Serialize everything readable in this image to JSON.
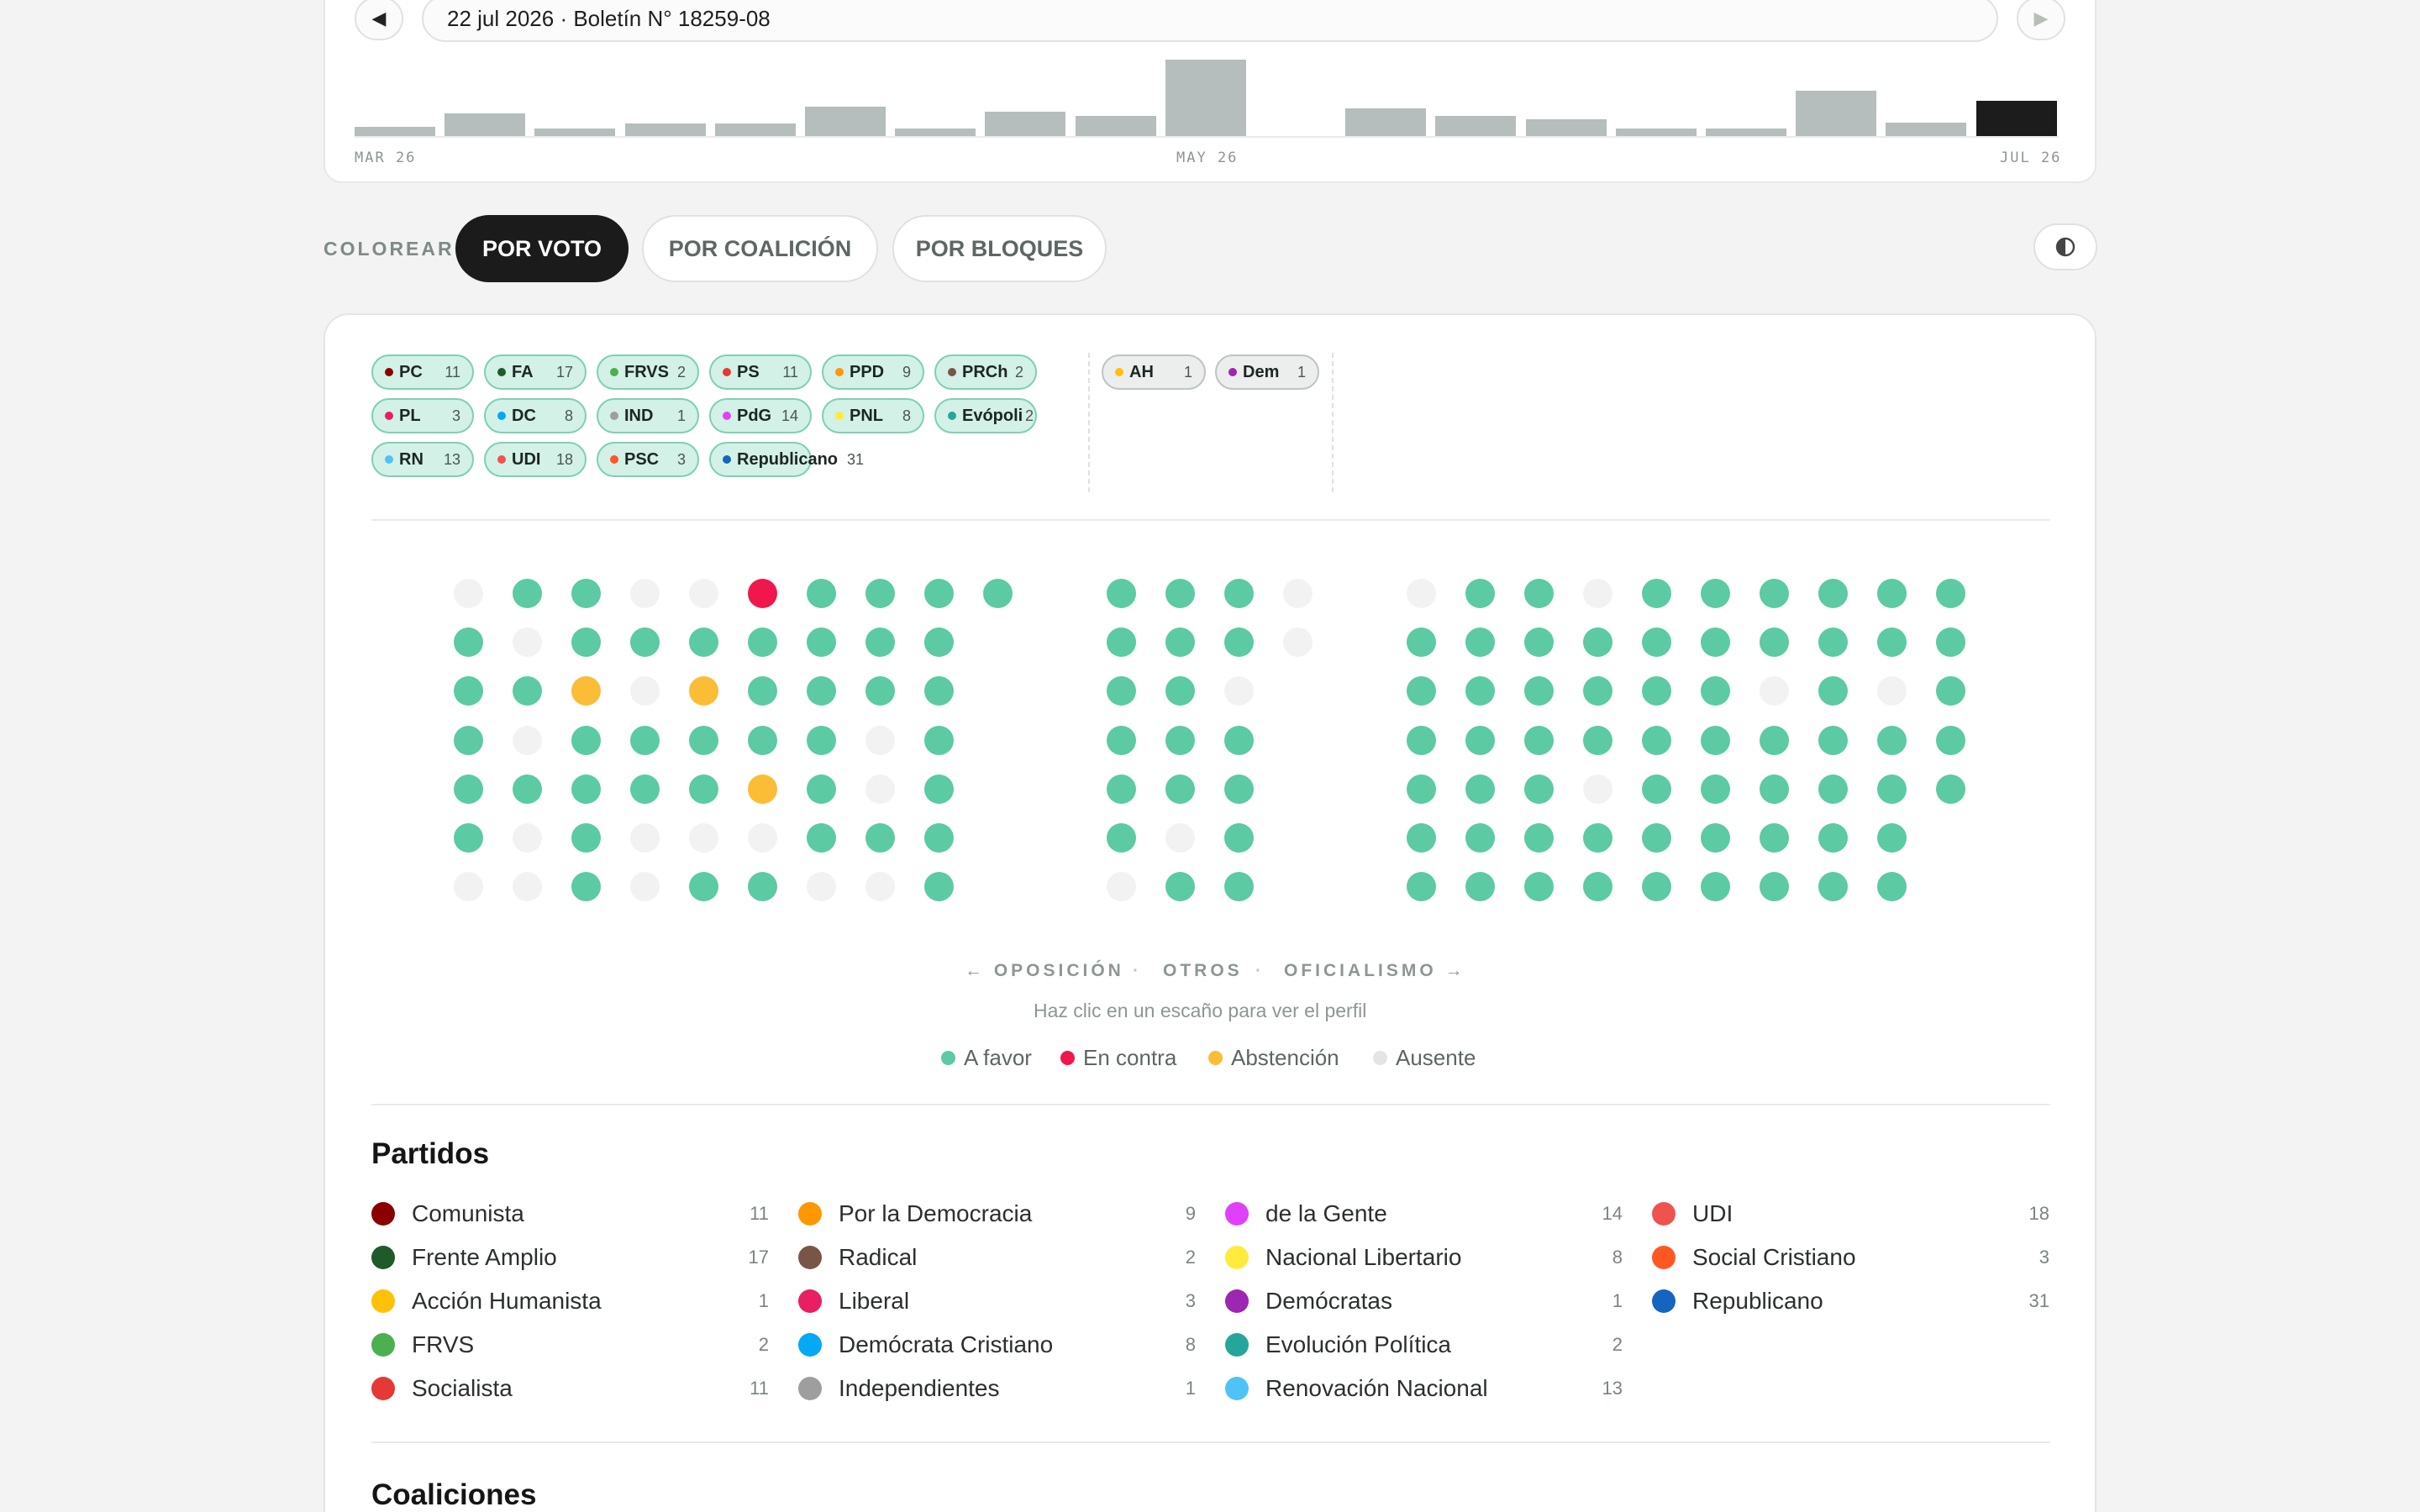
{
  "header": {
    "date_label": "22 jul 2026 · Boletín N° 18259-08",
    "prev_icon": "◀",
    "next_icon": "▶",
    "histogram": {
      "labels": [
        "MAR 26",
        "MAY 26",
        "JUL 26"
      ],
      "bars": [
        12,
        27,
        10,
        16,
        16,
        35,
        10,
        29,
        24,
        90,
        0,
        33,
        24,
        21,
        10,
        10,
        54,
        17,
        42
      ]
    }
  },
  "colorear": {
    "label": "COLOREAR:",
    "modes": [
      "POR VOTO",
      "POR COALICIÓN",
      "POR BLOQUES"
    ],
    "active": "POR VOTO"
  },
  "chips": {
    "main": [
      {
        "name": "PC",
        "count": "11",
        "color": "#8b0000"
      },
      {
        "name": "FA",
        "count": "17",
        "color": "#1e5a2a"
      },
      {
        "name": "FRVS",
        "count": "2",
        "color": "#4caf50"
      },
      {
        "name": "PS",
        "count": "11",
        "color": "#e53935"
      },
      {
        "name": "PPD",
        "count": "9",
        "color": "#ff9800"
      },
      {
        "name": "PRCh",
        "count": "2",
        "color": "#795548"
      },
      {
        "name": "PL",
        "count": "3",
        "color": "#e91e63"
      },
      {
        "name": "DC",
        "count": "8",
        "color": "#03a9f4"
      },
      {
        "name": "IND",
        "count": "1",
        "color": "#9e9e9e"
      },
      {
        "name": "PdG",
        "count": "14",
        "color": "#e040fb"
      },
      {
        "name": "PNL",
        "count": "8",
        "color": "#ffeb3b"
      },
      {
        "name": "Evópoli",
        "count": "2",
        "color": "#26a69a"
      },
      {
        "name": "RN",
        "count": "13",
        "color": "#4fc3f7"
      },
      {
        "name": "UDI",
        "count": "18",
        "color": "#ef5350"
      },
      {
        "name": "PSC",
        "count": "3",
        "color": "#ff5722"
      },
      {
        "name": "Republicano",
        "count": "31",
        "color": "#1565c0"
      }
    ],
    "others": [
      {
        "name": "AH",
        "count": "1",
        "color": "#ffc107"
      },
      {
        "name": "Dem",
        "count": "1",
        "color": "#9c27b0"
      }
    ]
  },
  "seats": {
    "states": {
      "F": "#5ccaa3",
      "C": "#f0174c",
      "A": "#fbbd36",
      "X": "#f1f2f1"
    },
    "opposition": [
      "XFFXXCFFFF",
      "FXFFFFFFF",
      "FFAXAFFFF",
      "FXFFFFFXF",
      "FFFFFAFXF",
      "FXFXXXFFF",
      "XXFXFFXXF"
    ],
    "others": [
      "FFFX",
      "FFFX",
      "FFX",
      "FFF",
      "FFF",
      "FXF",
      "XFF"
    ],
    "government": [
      "XFFXFFFFFF",
      "FFFFFFFFFF",
      "FFFFFFXFXF",
      "FFFFFFFFFF",
      "FFFXFFFFFF",
      "FFFFFFFFF",
      "FFFFFFFFF"
    ]
  },
  "sides": {
    "left": "← OPOSICIÓN",
    "middle": "OTROS",
    "right": "OFICIALISMO →",
    "sep": "·"
  },
  "hint": "Haz clic en un escaño para ver el perfil",
  "legend": [
    {
      "label": "A favor",
      "color": "#5ccaa3"
    },
    {
      "label": "En contra",
      "color": "#f0174c"
    },
    {
      "label": "Abstención",
      "color": "#fbbd36"
    },
    {
      "label": "Ausente",
      "color": "#e3e5e4"
    }
  ],
  "partidos": {
    "title": "Partidos",
    "columns": [
      [
        {
          "name": "Comunista",
          "count": "11",
          "color": "#8b0000"
        },
        {
          "name": "Frente Amplio",
          "count": "17",
          "color": "#1e5a2a"
        },
        {
          "name": "Acción Humanista",
          "count": "1",
          "color": "#ffc107"
        },
        {
          "name": "FRVS",
          "count": "2",
          "color": "#4caf50"
        },
        {
          "name": "Socialista",
          "count": "11",
          "color": "#e53935"
        }
      ],
      [
        {
          "name": "Por la Democracia",
          "count": "9",
          "color": "#ff9800"
        },
        {
          "name": "Radical",
          "count": "2",
          "color": "#795548"
        },
        {
          "name": "Liberal",
          "count": "3",
          "color": "#e91e63"
        },
        {
          "name": "Demócrata Cristiano",
          "count": "8",
          "color": "#03a9f4"
        },
        {
          "name": "Independientes",
          "count": "1",
          "color": "#9e9e9e"
        }
      ],
      [
        {
          "name": "de la Gente",
          "count": "14",
          "color": "#e040fb"
        },
        {
          "name": "Nacional Libertario",
          "count": "8",
          "color": "#ffeb3b"
        },
        {
          "name": "Demócratas",
          "count": "1",
          "color": "#9c27b0"
        },
        {
          "name": "Evolución Política",
          "count": "2",
          "color": "#26a69a"
        },
        {
          "name": "Renovación Nacional",
          "count": "13",
          "color": "#4fc3f7"
        }
      ],
      [
        {
          "name": "UDI",
          "count": "18",
          "color": "#ef5350"
        },
        {
          "name": "Social Cristiano",
          "count": "3",
          "color": "#ff5722"
        },
        {
          "name": "Republicano",
          "count": "31",
          "color": "#1565c0"
        }
      ]
    ]
  },
  "coaliciones": {
    "title": "Coaliciones"
  }
}
